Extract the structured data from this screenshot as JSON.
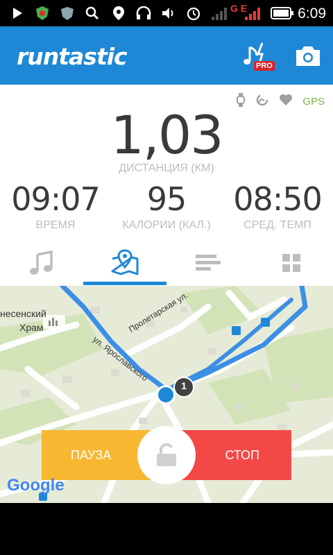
{
  "status_bar": {
    "time": "6:09",
    "network": "G E"
  },
  "app_bar": {
    "logo": "runtastic",
    "pro_badge": "PRO",
    "icons": [
      "music-pro-icon",
      "camera-icon"
    ]
  },
  "sensors": {
    "gps_label": "GPS",
    "icons": [
      "watch-icon",
      "cadence-icon",
      "heart-icon"
    ]
  },
  "distance": {
    "value": "1,03",
    "label": "ДИСТАНЦИЯ (КМ)"
  },
  "stats": [
    {
      "value": "09:07",
      "label": "ВРЕМЯ"
    },
    {
      "value": "95",
      "label": "КАЛОРИИ (КАЛ.)"
    },
    {
      "value": "08:50",
      "label": "СРЕД. ТЕМП"
    }
  ],
  "tabs": [
    {
      "icon": "music-icon",
      "active": false
    },
    {
      "icon": "map-icon",
      "active": true
    },
    {
      "icon": "stats-icon",
      "active": false
    },
    {
      "icon": "grid-icon",
      "active": false
    }
  ],
  "map": {
    "labels": [
      "Пролетарская ул.",
      "ул. Ярославского",
      "несенский",
      "Храм"
    ],
    "route_marker": "1",
    "attribution": "Google"
  },
  "controls": {
    "pause_label": "ПАУЗА",
    "stop_label": "СТОП",
    "lock_icon": "unlock-icon"
  },
  "colors": {
    "brand": "#1e88d6",
    "pause": "#f7b731",
    "stop": "#f44847",
    "gps": "#7cb342"
  }
}
